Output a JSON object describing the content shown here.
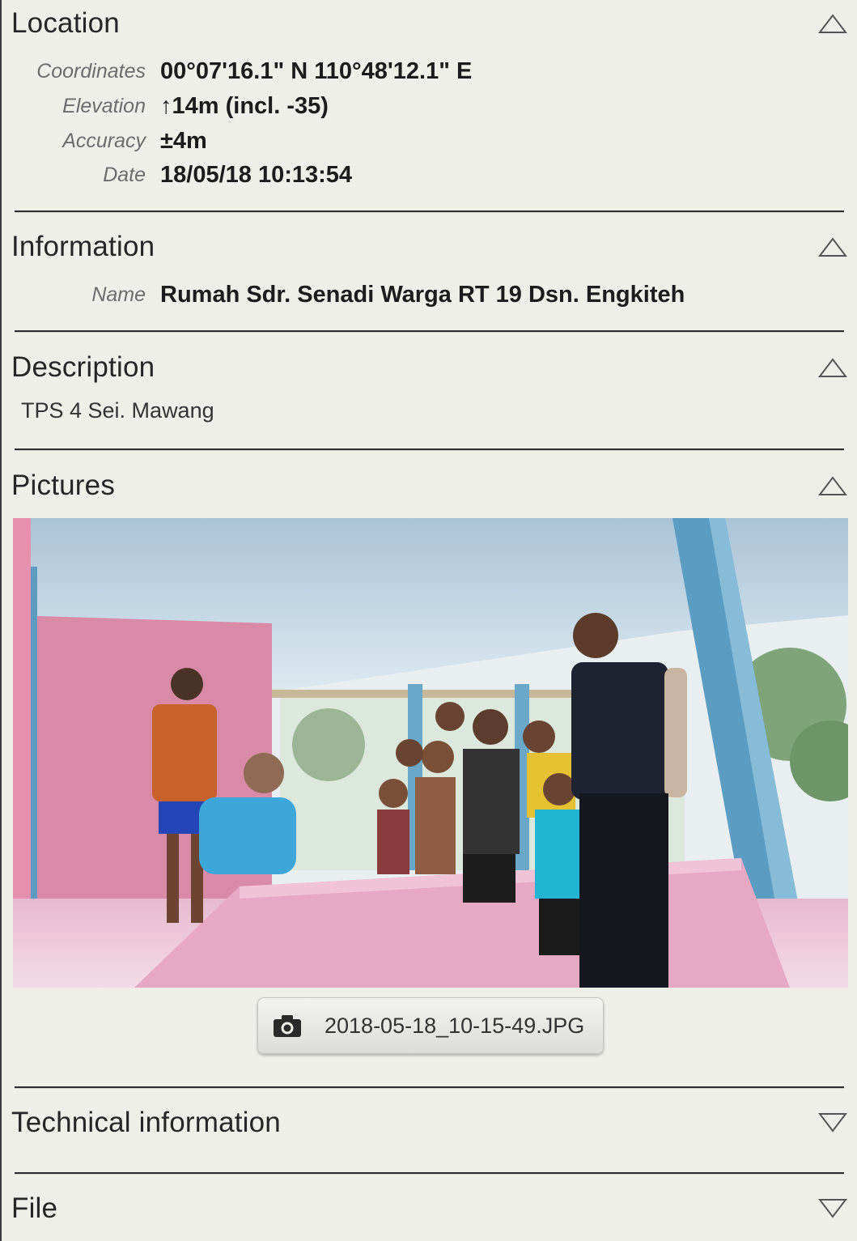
{
  "sections": {
    "location": {
      "title": "Location",
      "icon": "chevron-up-icon",
      "rows": [
        {
          "label": "Coordinates",
          "value": "00°07'16.1\" N 110°48'12.1\" E"
        },
        {
          "label": "Elevation",
          "value": "↑14m (incl. -35)"
        },
        {
          "label": "Accuracy",
          "value": "±4m"
        },
        {
          "label": "Date",
          "value": "18/05/18 10:13:54"
        }
      ]
    },
    "information": {
      "title": "Information",
      "icon": "chevron-up-icon",
      "rows": [
        {
          "label": "Name",
          "value": "Rumah Sdr. Senadi Warga RT 19 Dsn. Engkiteh"
        }
      ]
    },
    "description": {
      "title": "Description",
      "icon": "chevron-up-icon",
      "text": "TPS 4 Sei. Mawang"
    },
    "pictures": {
      "title": "Pictures",
      "icon": "chevron-up-icon",
      "file_name": "2018-05-18_10-15-49.JPG",
      "file_icon": "camera-icon"
    },
    "technical": {
      "title": "Technical information",
      "icon": "chevron-down-icon"
    },
    "file": {
      "title": "File",
      "icon": "chevron-down-icon"
    }
  },
  "colors": {
    "background": "#efefea",
    "divider": "#2e2e2e",
    "label": "#6c6c6c",
    "value": "#1c1c1c"
  }
}
